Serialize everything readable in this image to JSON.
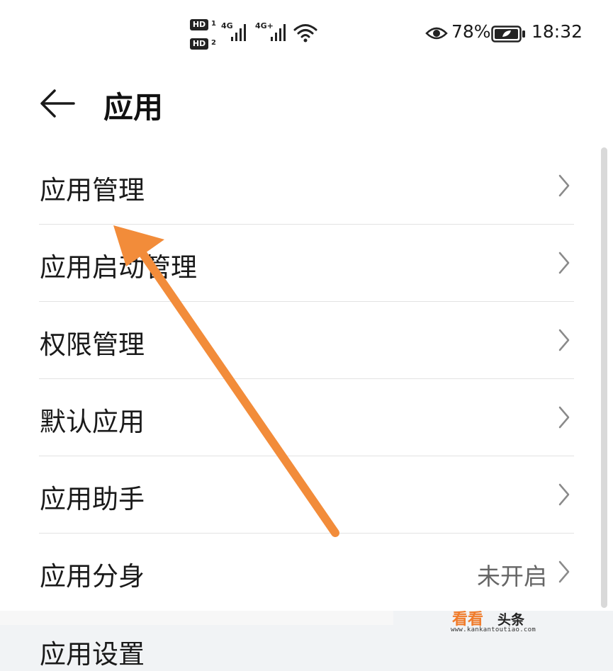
{
  "status_bar": {
    "sim1_badge": "HD",
    "sim1_num": "1",
    "sim2_badge": "HD",
    "sim2_num": "2",
    "net1_label": "4G",
    "net2_label": "4G+",
    "battery_percent": "78%",
    "time": "18:32",
    "icons": [
      "signal-icon",
      "wifi-icon",
      "eye-icon",
      "battery-icon"
    ]
  },
  "header": {
    "title": "应用",
    "back_icon": "back-arrow-icon"
  },
  "items": [
    {
      "label": "应用管理",
      "value": ""
    },
    {
      "label": "应用启动管理",
      "value": ""
    },
    {
      "label": "权限管理",
      "value": ""
    },
    {
      "label": "默认应用",
      "value": ""
    },
    {
      "label": "应用助手",
      "value": ""
    },
    {
      "label": "应用分身",
      "value": "未开启"
    }
  ],
  "next_section": {
    "label": "应用设置"
  },
  "watermark": {
    "main": "看看",
    "sub": "头条",
    "url": "www.kankantoutiao.com"
  },
  "colors": {
    "annotation_arrow": "#f28c3a",
    "watermark_accent": "#f07b2a",
    "divider": "#e2e2e2",
    "background": "#ffffff"
  }
}
